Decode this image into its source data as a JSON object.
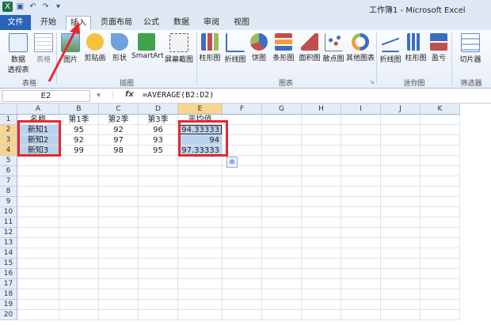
{
  "window": {
    "title": "工作簿1 - Microsoft Excel"
  },
  "tabs": [
    "文件",
    "开始",
    "插入",
    "页面布局",
    "公式",
    "数据",
    "审阅",
    "视图"
  ],
  "ribbon": {
    "groups": {
      "tables": "表格",
      "illustrations": "插图",
      "charts": "图表",
      "sparklines": "迷你图",
      "filter": "筛选器"
    },
    "buttons": {
      "pivot": "数据",
      "pivot2": "透视表",
      "table": "表格",
      "picture": "图片",
      "clipart": "剪贴画",
      "shapes": "形状",
      "smartart": "SmartArt",
      "screenshot": "屏幕截图",
      "col": "柱形图",
      "line": "折线图",
      "pie": "饼图",
      "bar": "条形图",
      "area": "面积图",
      "scatter": "散点图",
      "other": "其他图表",
      "sp_line": "折线图",
      "sp_col": "柱形图",
      "sp_wl": "盈亏",
      "slicer": "切片器"
    },
    "colors": {
      "accent": "#2a64b7"
    }
  },
  "formula": {
    "namebox": "E2",
    "fx": "fx",
    "value": "=AVERAGE(B2:D2)"
  },
  "sheet": {
    "columns": [
      "A",
      "B",
      "C",
      "D",
      "E",
      "F",
      "G",
      "H",
      "I",
      "J",
      "K"
    ],
    "rows": [
      "1",
      "2",
      "3",
      "4",
      "5",
      "6",
      "7",
      "8",
      "9",
      "10",
      "11",
      "12",
      "13",
      "14",
      "15",
      "16",
      "17",
      "18",
      "19",
      "20"
    ],
    "header": [
      "名称",
      "第1季",
      "第2季",
      "第3季",
      "平均值"
    ],
    "data": [
      [
        "新知1",
        "95",
        "92",
        "96",
        "94.33333"
      ],
      [
        "新知2",
        "92",
        "97",
        "93",
        "94"
      ],
      [
        "新知3",
        "99",
        "98",
        "95",
        "97.33333"
      ]
    ]
  }
}
